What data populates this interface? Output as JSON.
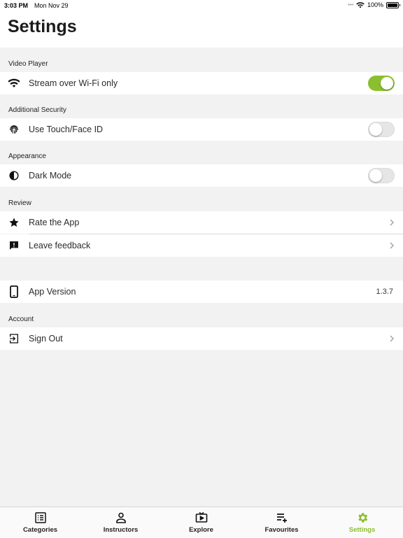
{
  "status": {
    "time": "3:03 PM",
    "date": "Mon Nov 29",
    "battery": "100%"
  },
  "header": {
    "title": "Settings"
  },
  "sections": {
    "video_player": {
      "label": "Video Player",
      "stream_label": "Stream over Wi-Fi only",
      "stream_on": true
    },
    "security": {
      "label": "Additional Security",
      "touch_label": "Use Touch/Face ID",
      "touch_on": false
    },
    "appearance": {
      "label": "Appearance",
      "dark_label": "Dark Mode",
      "dark_on": false
    },
    "review": {
      "label": "Review",
      "rate_label": "Rate the App",
      "feedback_label": "Leave feedback"
    },
    "version": {
      "label": "App Version",
      "value": "1.3.7"
    },
    "account": {
      "label": "Account",
      "signout_label": "Sign Out"
    }
  },
  "tabs": [
    {
      "label": "Categories",
      "icon": "list-icon"
    },
    {
      "label": "Instructors",
      "icon": "person-icon"
    },
    {
      "label": "Explore",
      "icon": "tv-play-icon"
    },
    {
      "label": "Favourites",
      "icon": "playlist-add-icon"
    },
    {
      "label": "Settings",
      "icon": "gear-icon",
      "active": true
    }
  ],
  "colors": {
    "accent": "#8cbf2f",
    "background": "#f2f2f2",
    "row": "#ffffff"
  }
}
